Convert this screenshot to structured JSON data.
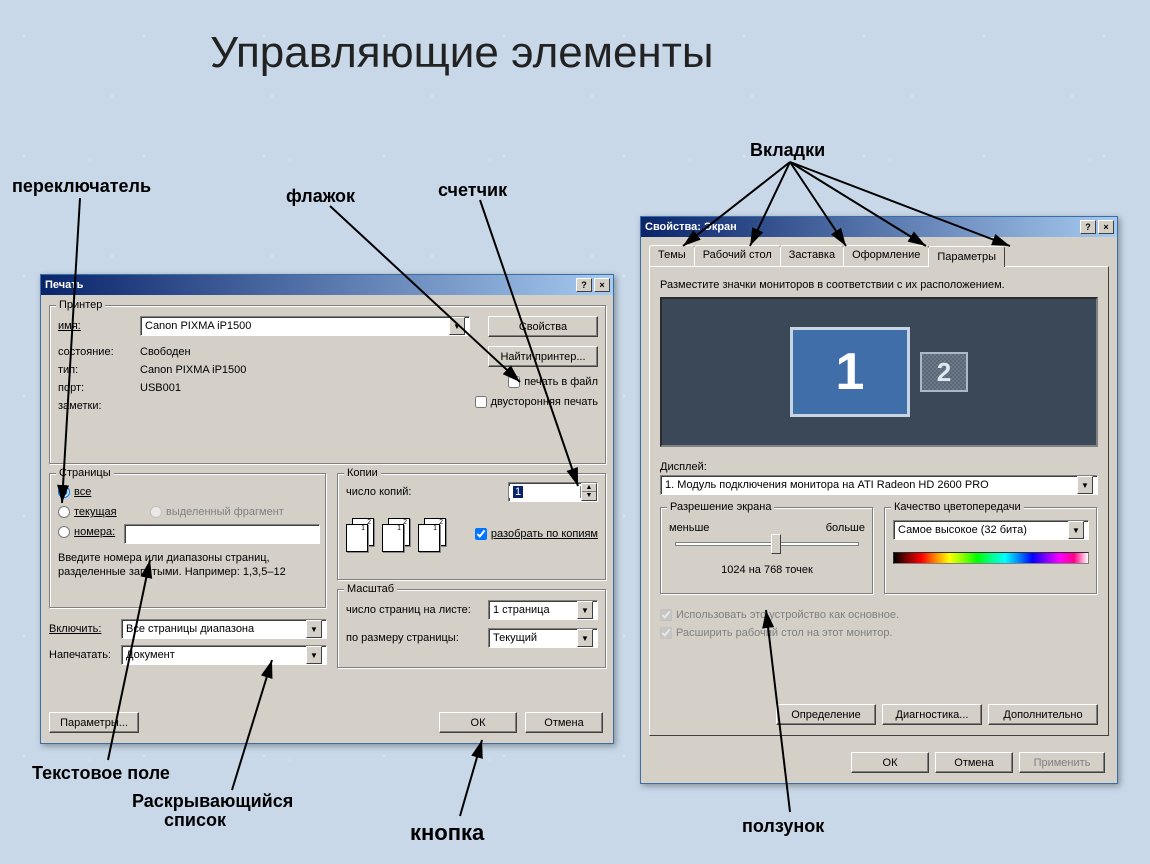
{
  "slide": {
    "title": "Управляющие элементы"
  },
  "annotations": {
    "tabs": "Вкладки",
    "radio": "переключатель",
    "checkbox": "флажок",
    "spinner": "счетчик",
    "textfield": "Текстовое поле",
    "dropdown_l1": "Раскрывающийся",
    "dropdown_l2": "список",
    "button": "кнопка",
    "slider": "ползунок"
  },
  "print": {
    "title": "Печать",
    "printer_group": "Принтер",
    "name_label": "имя:",
    "status_label": "состояние:",
    "type_label": "тип:",
    "port_label": "порт:",
    "notes_label": "заметки:",
    "printer_name": "Canon PIXMA iP1500",
    "status": "Свободен",
    "type": "Canon PIXMA iP1500",
    "port": "USB001",
    "btn_props": "Свойства",
    "btn_find": "Найти принтер...",
    "chk_tofile": "печать в файл",
    "chk_duplex": "двусторонняя печать",
    "pages_group": "Страницы",
    "radio_all": "все",
    "radio_current": "текущая",
    "radio_sel": "выделенный фрагмент",
    "radio_numbers": "номера:",
    "pages_hint": "Введите номера или диапазоны страниц, разделенные запятыми. Например: 1,3,5–12",
    "include_label": "Включить:",
    "include_val": "Все страницы диапазона",
    "printwhat_label": "Напечатать:",
    "printwhat_val": "Документ",
    "copies_group": "Копии",
    "copies_label": "число копий:",
    "copies_val": "1",
    "collate": "разобрать по копиям",
    "scale_group": "Масштаб",
    "ppp_label": "число страниц на листе:",
    "ppp_val": "1 страница",
    "fit_label": "по размеру страницы:",
    "fit_val": "Текущий",
    "btn_params": "Параметры...",
    "btn_ok": "ОК",
    "btn_cancel": "Отмена"
  },
  "display": {
    "title": "Свойства: Экран",
    "tabs": [
      "Темы",
      "Рабочий стол",
      "Заставка",
      "Оформление",
      "Параметры"
    ],
    "hint": "Разместите значки мониторов в соответствии с их расположением.",
    "mon1": "1",
    "mon2": "2",
    "display_label": "Дисплей:",
    "display_val": "1. Модуль подключения монитора на ATI Radeon HD 2600 PRO",
    "res_group": "Разрешение экрана",
    "less": "меньше",
    "more": "больше",
    "res_val": "1024 на 768 точек",
    "quality_group": "Качество цветопередачи",
    "quality_val": "Самое высокое (32 бита)",
    "chk_primary": "Использовать это устройство как основное.",
    "chk_extend": "Расширить рабочий стол на этот монитор.",
    "btn_identify": "Определение",
    "btn_diag": "Диагностика...",
    "btn_adv": "Дополнительно",
    "btn_ok": "ОК",
    "btn_cancel": "Отмена",
    "btn_apply": "Применить"
  }
}
